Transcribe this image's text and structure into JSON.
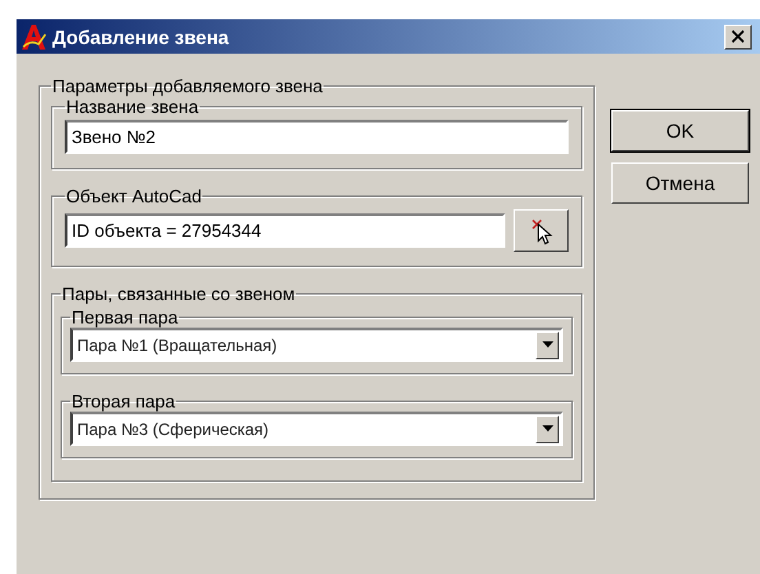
{
  "window": {
    "title": "Добавление звена"
  },
  "params_group": {
    "label": "Параметры добавляемого звена"
  },
  "name_group": {
    "label": "Название звена",
    "value": "Звено №2"
  },
  "object_group": {
    "label": "Объект AutoCad",
    "value": "ID объекта = 27954344"
  },
  "pairs_group": {
    "label": "Пары, связанные со звеном",
    "pairs": [
      {
        "label": "Первая пара",
        "value": "Пара №1 (Вращательная)"
      },
      {
        "label": "Вторая пара",
        "value": "Пара №3 (Сферическая)"
      }
    ]
  },
  "buttons": [
    {
      "label": "OK",
      "default": true
    },
    {
      "label": "Отмена",
      "default": false
    }
  ]
}
